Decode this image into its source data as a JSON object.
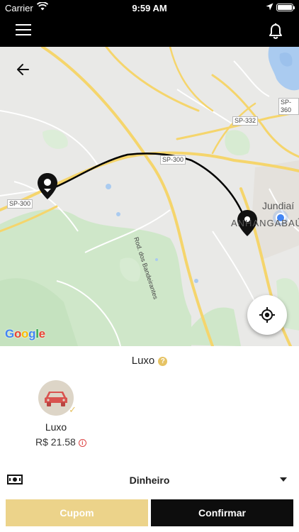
{
  "status_bar": {
    "carrier": "Carrier",
    "time": "9:59 AM"
  },
  "header": {
    "menu_icon": "hamburger-icon",
    "notification_icon": "bell-icon"
  },
  "map": {
    "back_icon": "arrow-left-icon",
    "locate_icon": "crosshair-icon",
    "attribution": "Google",
    "road_labels": [
      "SP-300",
      "SP-300",
      "SP-332",
      "SP-360",
      "Rod. dos Bandeirantes"
    ],
    "place_labels": [
      "Jundiaí",
      "ANHANGABAÚ"
    ]
  },
  "ride": {
    "category_title": "Luxo",
    "help_icon": "question-icon",
    "vehicle": {
      "icon": "car-icon",
      "name": "Luxo",
      "price": "R$ 21.58",
      "info_icon": "info-icon"
    }
  },
  "payment": {
    "method": "Dinheiro",
    "icon": "cash-icon",
    "dropdown_icon": "caret-down-icon"
  },
  "actions": {
    "coupon_label": "Cupom",
    "confirm_label": "Confirmar"
  },
  "colors": {
    "accent": "#e6c364",
    "header_bg": "#000000",
    "car": "#d9534f",
    "coupon_bg": "#ecd38a"
  }
}
